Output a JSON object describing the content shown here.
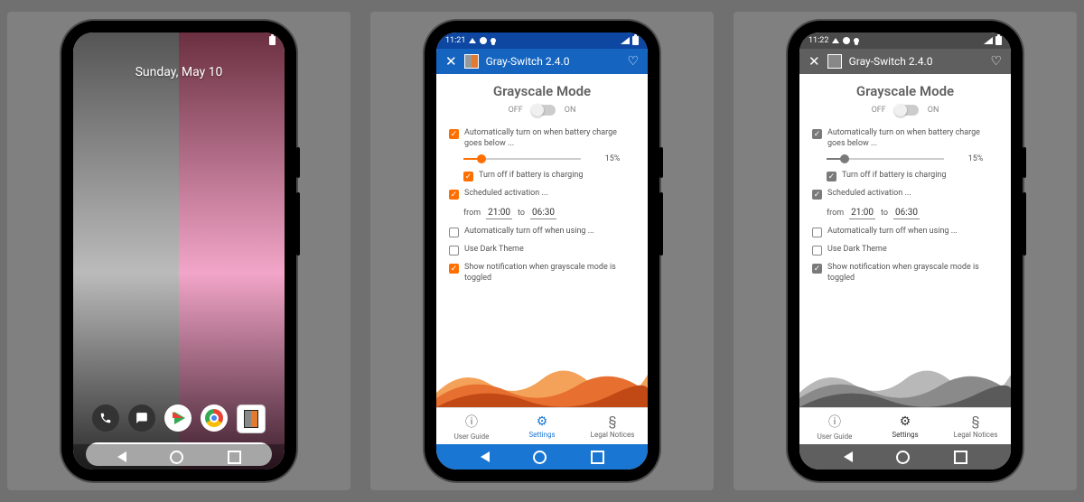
{
  "status_time_a": "11:21",
  "status_time_b": "11:22",
  "home": {
    "date": "Sunday, May 10"
  },
  "app": {
    "title": "Gray-Switch 2.4.0",
    "heading": "Grayscale Mode",
    "off_label": "OFF",
    "on_label": "ON",
    "auto_on_battery": "Automatically turn on when battery charge goes below ...",
    "battery_pct": "15%",
    "turn_off_charging": "Turn off if battery is charging",
    "scheduled": "Scheduled activation ...",
    "from_label": "from",
    "to_label": "to",
    "time_from": "21:00",
    "time_to": "06:30",
    "auto_off_using": "Automatically turn off when using ...",
    "dark_theme": "Use Dark Theme",
    "show_notif": "Show notification when grayscale mode is toggled",
    "tab_guide": "User Guide",
    "tab_settings": "Settings",
    "tab_legal": "Legal Notices"
  }
}
